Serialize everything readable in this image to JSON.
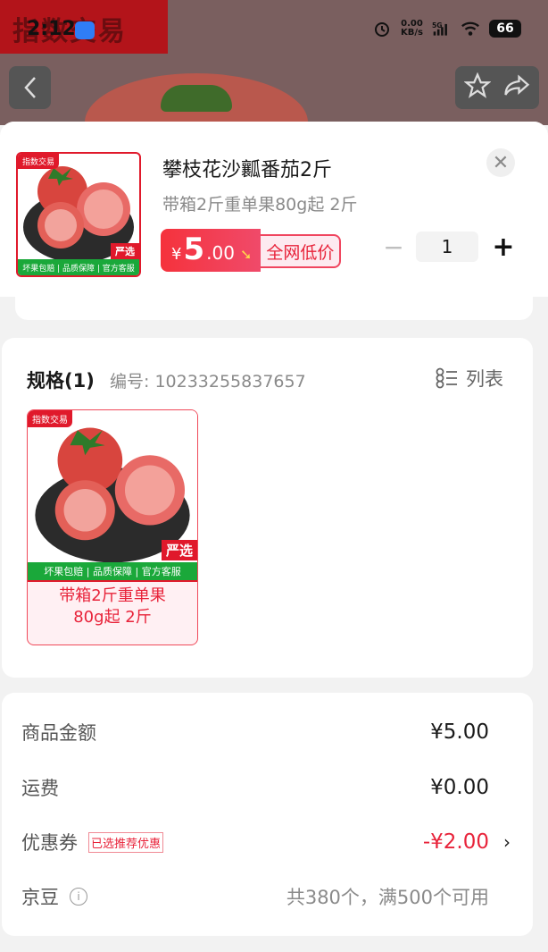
{
  "status_bar": {
    "time": "2:12",
    "net_speed": "0.00",
    "net_unit": "KB/s",
    "signal_label": "5G",
    "battery": "66"
  },
  "background": {
    "banner": "指数交易"
  },
  "product": {
    "title": "攀枝花沙瓤番茄2斤",
    "subtitle": "带箱2斤重单果80g起 2斤",
    "thumb_tag": "指数交易",
    "thumb_yan": "严选",
    "thumb_strip": "坏果包赔 | 品质保障 | 官方客服",
    "price_currency": "¥",
    "price_int": "5",
    "price_dec": ".00",
    "price_tag": "全网低价",
    "quantity": "1"
  },
  "spec": {
    "title": "规格(1)",
    "code": "编号: 10233255837657",
    "list_label": "列表",
    "option": {
      "tag": "指数交易",
      "yan": "严选",
      "strip": "坏果包赔 | 品质保障 | 官方客服",
      "label_line1": "带箱2斤重单果",
      "label_line2": "80g起 2斤"
    }
  },
  "summary": {
    "amount_label": "商品金额",
    "amount_value": "¥5.00",
    "shipping_label": "运费",
    "shipping_value": "¥0.00",
    "coupon_label": "优惠券",
    "coupon_badge": "已选推荐优惠",
    "coupon_value": "-¥2.00",
    "jd_label": "京豆",
    "jd_value": "共380个，满500个可用"
  },
  "colors": {
    "accent_red": "#e8233a",
    "green_strip": "#1aa83a"
  }
}
